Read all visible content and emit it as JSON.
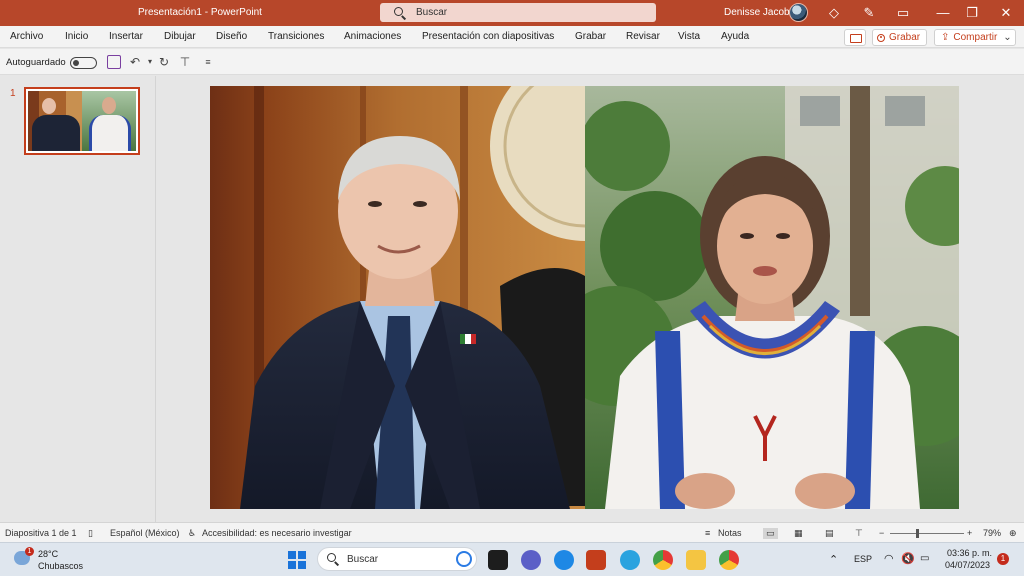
{
  "titlebar": {
    "doc_title": "Presentación1  -  PowerPoint",
    "search_placeholder": "Buscar",
    "user_name": "Denisse Jacobo"
  },
  "ribbon": {
    "tabs": [
      "Archivo",
      "Inicio",
      "Insertar",
      "Dibujar",
      "Diseño",
      "Transiciones",
      "Animaciones",
      "Presentación con diapositivas",
      "Grabar",
      "Revisar",
      "Vista",
      "Ayuda"
    ],
    "record_label": "Grabar",
    "share_label": "Compartir"
  },
  "qat": {
    "autosave_label": "Autoguardado"
  },
  "slides_panel": {
    "slide_number": "1"
  },
  "statusbar": {
    "slide_info": "Diapositiva 1 de 1",
    "language": "Español (México)",
    "accessibility": "Accesibilidad: es necesario investigar",
    "notes_label": "Notas",
    "zoom": "79%",
    "zoom_minus": "−",
    "zoom_plus": "+"
  },
  "taskbar": {
    "weather_temp": "28°C",
    "weather_desc": "Chubascos",
    "weather_badge": "1",
    "search_placeholder": "Buscar",
    "language": "ESP",
    "time": "03:36 p. m.",
    "date": "04/07/2023",
    "notification_count": "1"
  },
  "colors": {
    "accent": "#b7472a",
    "ribbon_bg": "#f3f3f3"
  }
}
